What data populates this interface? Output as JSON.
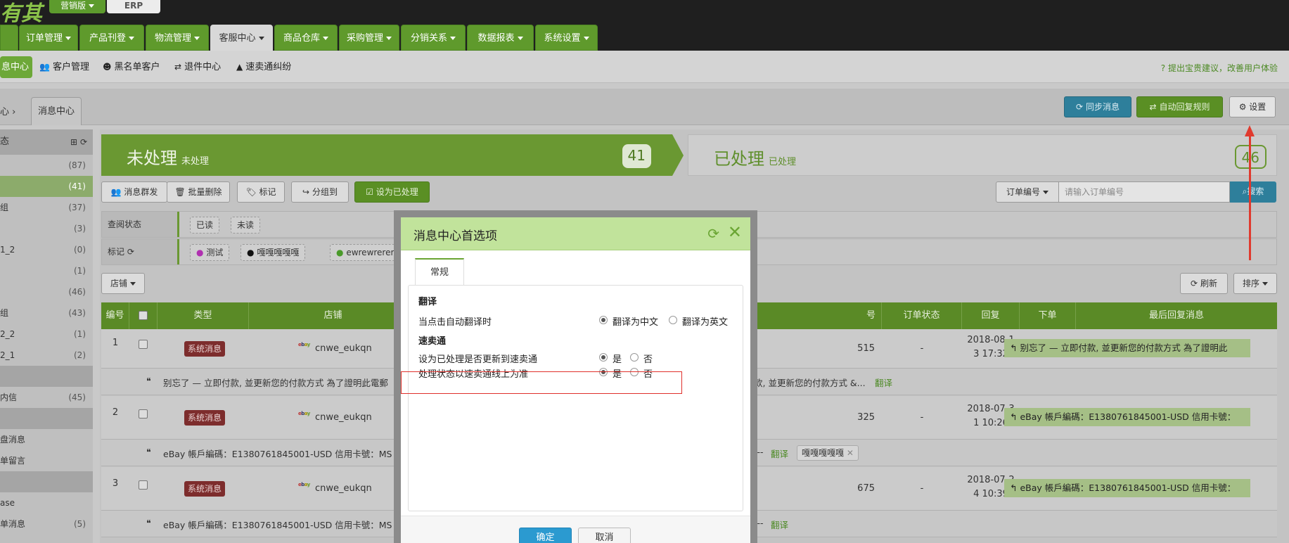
{
  "header": {
    "logo": "有其",
    "edition": "营销版",
    "erp": "ERP"
  },
  "nav": [
    {
      "label": "订单管理"
    },
    {
      "label": "产品刊登"
    },
    {
      "label": "物流管理"
    },
    {
      "label": "客服中心"
    },
    {
      "label": "商品仓库"
    },
    {
      "label": "采购管理"
    },
    {
      "label": "分销关系"
    },
    {
      "label": "数据报表"
    },
    {
      "label": "系统设置"
    }
  ],
  "subnav": {
    "items": [
      {
        "label": "息中心"
      },
      {
        "label": "客户管理"
      },
      {
        "label": "黑名单客户"
      },
      {
        "label": "退件中心"
      },
      {
        "label": "速卖通纠纷"
      }
    ],
    "suggest": "提出宝贵建议，改善用户体验"
  },
  "breadcrumb": {
    "prev": "心 ›",
    "current": "消息中心"
  },
  "actions": {
    "sync": "同步消息",
    "auto_reply": "自动回复规则",
    "settings": "设置"
  },
  "sidebar": {
    "head": "态",
    "rows": [
      {
        "label": "",
        "count": "(87)"
      },
      {
        "label": "",
        "count": "(41)"
      },
      {
        "label": "组",
        "count": "(37)"
      },
      {
        "label": "",
        "count": "(3)"
      },
      {
        "label": "1_2",
        "count": "(0)"
      },
      {
        "label": "",
        "count": "(1)"
      },
      {
        "label": "",
        "count": "(46)"
      },
      {
        "label": "组",
        "count": "(43)"
      },
      {
        "label": "2_2",
        "count": "(1)"
      },
      {
        "label": "2_1",
        "count": "(2)"
      },
      {
        "label": "",
        "count": ""
      },
      {
        "label": "内信",
        "count": "(45)"
      },
      {
        "label": "",
        "count": ""
      },
      {
        "label": "盘消息",
        "count": ""
      },
      {
        "label": "单留言",
        "count": ""
      },
      {
        "label": "",
        "count": ""
      },
      {
        "label": "ase",
        "count": ""
      },
      {
        "label": "单消息",
        "count": "(5)"
      }
    ]
  },
  "status": {
    "pending_title": "未处理",
    "pending_sub": "未处理",
    "pending_count": "41",
    "done_title": "已处理",
    "done_sub": "已处理",
    "done_count": "46"
  },
  "toolbar": {
    "mass_send": "消息群发",
    "batch_delete": "批量删除",
    "mark": "标记",
    "group": "分组到",
    "set_done": "设为已处理",
    "order_select": "订单编号",
    "order_placeholder": "请输入订单编号",
    "search": "搜索"
  },
  "filters": {
    "read_label": "查阅状态",
    "read_opts": [
      "已读",
      "未读"
    ],
    "mark_label": "标记",
    "mark_opts": [
      "测试",
      "嘎嘎嘎嘎嘎",
      "ewrewrerere"
    ]
  },
  "list_controls": {
    "store": "店铺",
    "refresh": "刷新",
    "sort": "排序"
  },
  "table": {
    "headers": [
      "编号",
      "",
      "类型",
      "店铺",
      "号",
      "订单状态",
      "回复",
      "下单",
      "最后回复消息"
    ],
    "rows": [
      {
        "no": "1",
        "type": "系统消息",
        "store": "cnwe_eukqn",
        "order": "515",
        "order_status": "-",
        "reply_date": "2018-08-1",
        "reply_time": "3 17:32",
        "placed": "-",
        "last": "别忘了 — 立即付款, 並更新您的付款方式 為了證明此",
        "sub_left": "别忘了 — 立即付款, 並更新您的付款方式 為了證明此電郵",
        "sub_right": "款, 並更新您的付款方式   &...",
        "translate": "翻译"
      },
      {
        "no": "2",
        "type": "系统消息",
        "store": "cnwe_eukqn",
        "order": "325",
        "order_status": "-",
        "reply_date": "2018-07-3",
        "reply_time": "1 10:26",
        "placed": "-",
        "last": "eBay 帳戶編碼：E1380761845001-USD 信用卡號：",
        "sub_left": "eBay 帳戶編碼：E1380761845001-USD 信用卡號：MS",
        "sub_right": "---",
        "translate": "翻译",
        "tag": "嘎嘎嘎嘎嘎"
      },
      {
        "no": "3",
        "type": "系统消息",
        "store": "cnwe_eukqn",
        "order": "675",
        "order_status": "-",
        "reply_date": "2018-07-2",
        "reply_time": "4 10:39",
        "placed": "-",
        "last": "eBay 帳戶編碼：E1380761845001-USD 信用卡號：",
        "sub_left": "eBay 帳戶編碼：E1380761845001-USD 信用卡號：MS",
        "sub_right": "---",
        "translate": "翻译"
      }
    ]
  },
  "modal": {
    "title": "消息中心首选项",
    "tab": "常规",
    "sec1": "翻译",
    "opt1": "当点击自动翻译时",
    "opt1_a": "翻译为中文",
    "opt1_b": "翻译为英文",
    "sec2": "速卖通",
    "opt2": "设为已处理是否更新到速卖通",
    "opt3": "处理状态以速卖通线上为准",
    "yes": "是",
    "no": "否",
    "ok": "确定",
    "cancel": "取消"
  },
  "colors": {
    "brand_green": "#6a9832",
    "highlight_red": "#e0302b",
    "info_blue": "#2e7f9b"
  }
}
